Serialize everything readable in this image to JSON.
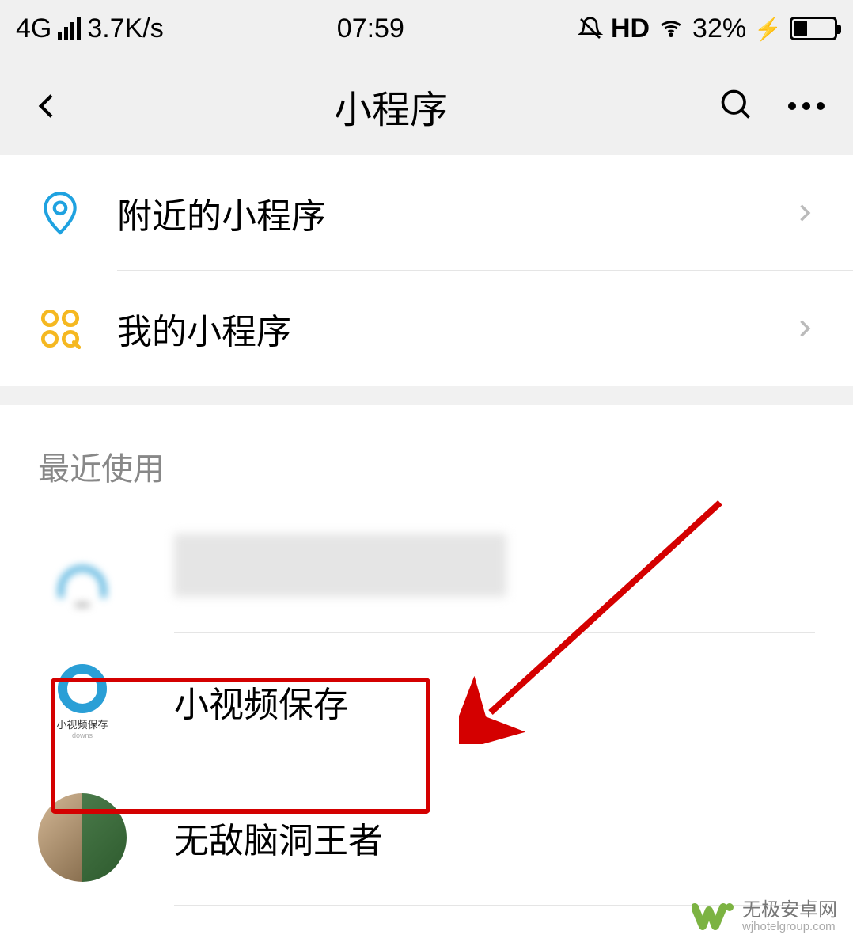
{
  "status_bar": {
    "network_type": "4G",
    "data_rate": "3.7K/s",
    "time": "07:59",
    "hd_label": "HD",
    "battery_pct": "32%"
  },
  "header": {
    "title": "小程序"
  },
  "menu": {
    "nearby": {
      "label": "附近的小程序"
    },
    "mine": {
      "label": "我的小程序"
    }
  },
  "recent": {
    "title": "最近使用",
    "items": [
      {
        "label": ""
      },
      {
        "label": "小视频保存",
        "icon_caption": "小视频保存",
        "icon_sub": "downs"
      },
      {
        "label": "无敌脑洞王者"
      }
    ]
  },
  "watermark": {
    "main": "无极安卓网",
    "sub": "wjhotelgroup.com"
  }
}
